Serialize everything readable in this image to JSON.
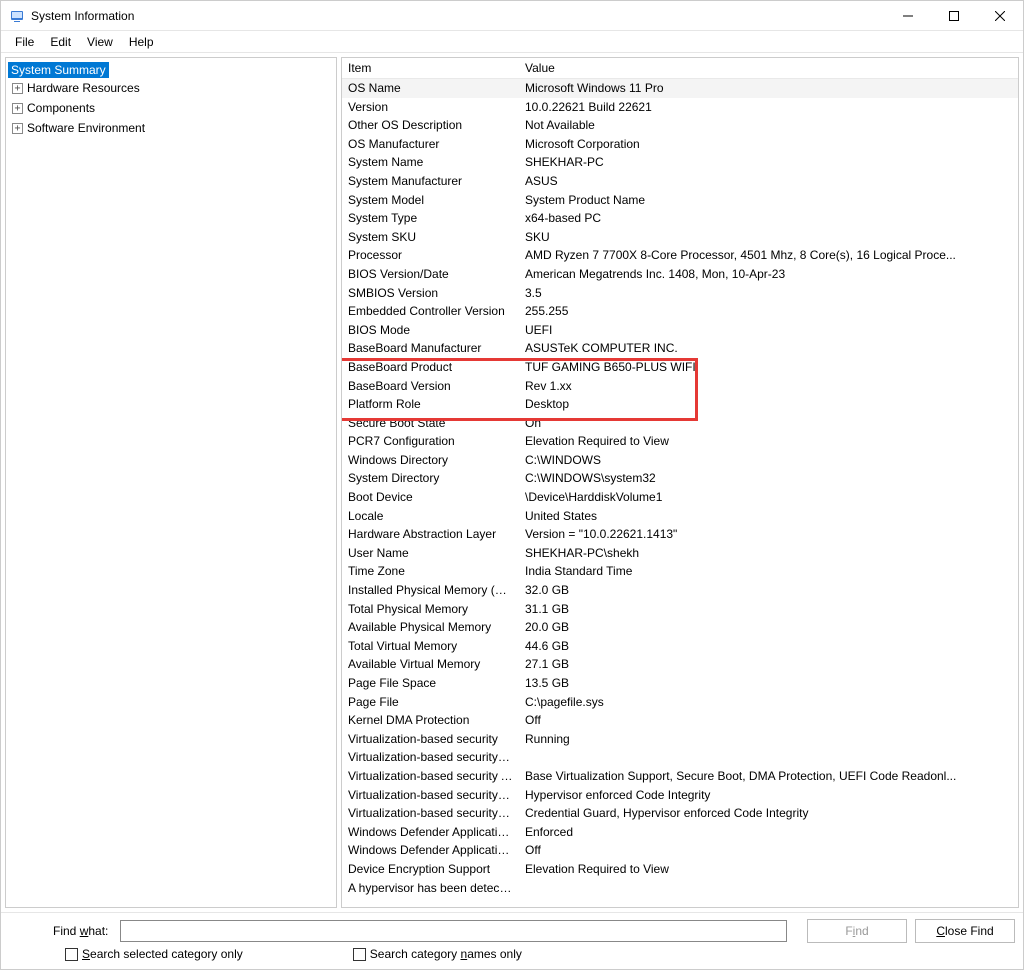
{
  "window": {
    "title": "System Information"
  },
  "menu": {
    "file": "File",
    "edit": "Edit",
    "view": "View",
    "help": "Help"
  },
  "tree": {
    "root": "System Summary",
    "children": [
      "Hardware Resources",
      "Components",
      "Software Environment"
    ]
  },
  "columns": {
    "item": "Item",
    "value": "Value"
  },
  "rows": [
    {
      "item": "OS Name",
      "value": "Microsoft Windows 11 Pro"
    },
    {
      "item": "Version",
      "value": "10.0.22621 Build 22621"
    },
    {
      "item": "Other OS Description",
      "value": "Not Available"
    },
    {
      "item": "OS Manufacturer",
      "value": "Microsoft Corporation"
    },
    {
      "item": "System Name",
      "value": "SHEKHAR-PC"
    },
    {
      "item": "System Manufacturer",
      "value": "ASUS"
    },
    {
      "item": "System Model",
      "value": "System Product Name"
    },
    {
      "item": "System Type",
      "value": "x64-based PC"
    },
    {
      "item": "System SKU",
      "value": "SKU"
    },
    {
      "item": "Processor",
      "value": "AMD Ryzen 7 7700X 8-Core Processor, 4501 Mhz, 8 Core(s), 16 Logical Proce..."
    },
    {
      "item": "BIOS Version/Date",
      "value": "American Megatrends Inc. 1408, Mon, 10-Apr-23"
    },
    {
      "item": "SMBIOS Version",
      "value": "3.5"
    },
    {
      "item": "Embedded Controller Version",
      "value": "255.255"
    },
    {
      "item": "BIOS Mode",
      "value": "UEFI"
    },
    {
      "item": "BaseBoard Manufacturer",
      "value": "ASUSTeK COMPUTER INC."
    },
    {
      "item": "BaseBoard Product",
      "value": "TUF GAMING B650-PLUS WIFI"
    },
    {
      "item": "BaseBoard Version",
      "value": "Rev 1.xx"
    },
    {
      "item": "Platform Role",
      "value": "Desktop"
    },
    {
      "item": "Secure Boot State",
      "value": "On"
    },
    {
      "item": "PCR7 Configuration",
      "value": "Elevation Required to View"
    },
    {
      "item": "Windows Directory",
      "value": "C:\\WINDOWS"
    },
    {
      "item": "System Directory",
      "value": "C:\\WINDOWS\\system32"
    },
    {
      "item": "Boot Device",
      "value": "\\Device\\HarddiskVolume1"
    },
    {
      "item": "Locale",
      "value": "United States"
    },
    {
      "item": "Hardware Abstraction Layer",
      "value": "Version = \"10.0.22621.1413\""
    },
    {
      "item": "User Name",
      "value": "SHEKHAR-PC\\shekh"
    },
    {
      "item": "Time Zone",
      "value": "India Standard Time"
    },
    {
      "item": "Installed Physical Memory (RAM)",
      "value": "32.0 GB"
    },
    {
      "item": "Total Physical Memory",
      "value": "31.1 GB"
    },
    {
      "item": "Available Physical Memory",
      "value": "20.0 GB"
    },
    {
      "item": "Total Virtual Memory",
      "value": "44.6 GB"
    },
    {
      "item": "Available Virtual Memory",
      "value": "27.1 GB"
    },
    {
      "item": "Page File Space",
      "value": "13.5 GB"
    },
    {
      "item": "Page File",
      "value": "C:\\pagefile.sys"
    },
    {
      "item": "Kernel DMA Protection",
      "value": "Off"
    },
    {
      "item": "Virtualization-based security",
      "value": "Running"
    },
    {
      "item": "Virtualization-based security Re...",
      "value": ""
    },
    {
      "item": "Virtualization-based security Av...",
      "value": "Base Virtualization Support, Secure Boot, DMA Protection, UEFI Code Readonl..."
    },
    {
      "item": "Virtualization-based security Se...",
      "value": "Hypervisor enforced Code Integrity"
    },
    {
      "item": "Virtualization-based security Se...",
      "value": "Credential Guard, Hypervisor enforced Code Integrity"
    },
    {
      "item": "Windows Defender Application...",
      "value": "Enforced"
    },
    {
      "item": "Windows Defender Application...",
      "value": "Off"
    },
    {
      "item": "Device Encryption Support",
      "value": "Elevation Required to View"
    },
    {
      "item": "A hypervisor has been detecte...",
      "value": ""
    }
  ],
  "find": {
    "label_pre": "Find ",
    "label_ul": "w",
    "label_post": "hat:",
    "input_value": "",
    "find_btn_pre": "F",
    "find_btn_ul": "i",
    "find_btn_post": "nd",
    "close_btn_ul": "C",
    "close_btn_post": "lose Find",
    "chk1_ul": "S",
    "chk1_post": "earch selected category only",
    "chk2_pre": "Search category ",
    "chk2_ul": "n",
    "chk2_post": "ames only"
  }
}
